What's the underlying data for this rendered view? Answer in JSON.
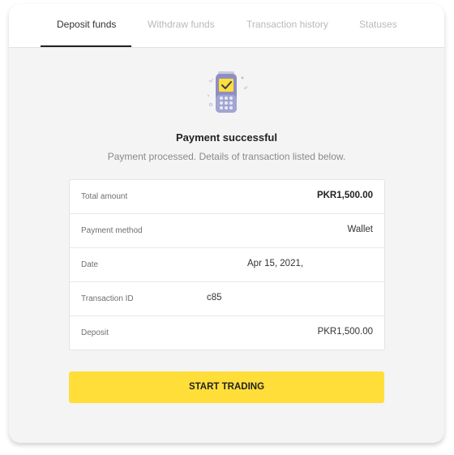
{
  "tabs": [
    {
      "label": "Deposit funds",
      "active": true
    },
    {
      "label": "Withdraw funds",
      "active": false
    },
    {
      "label": "Transaction history",
      "active": false
    },
    {
      "label": "Statuses",
      "active": false
    }
  ],
  "status": {
    "icon": "payment-terminal-check-icon",
    "title": "Payment successful",
    "subtitle": "Payment processed. Details of transaction listed below."
  },
  "details": {
    "rows": [
      {
        "label": "Total amount",
        "value": "PKR1,500.00"
      },
      {
        "label": "Payment method",
        "value": "Wallet"
      },
      {
        "label": "Date",
        "value": "Apr 15, 2021,"
      },
      {
        "label": "Transaction ID",
        "value": "c85"
      },
      {
        "label": "Deposit",
        "value": "PKR1,500.00"
      }
    ]
  },
  "actions": {
    "start_trading_label": "START TRADING"
  },
  "colors": {
    "accent": "#ffde3a",
    "background": "#f4f4f4",
    "icon_purple": "#8d8fc4"
  }
}
